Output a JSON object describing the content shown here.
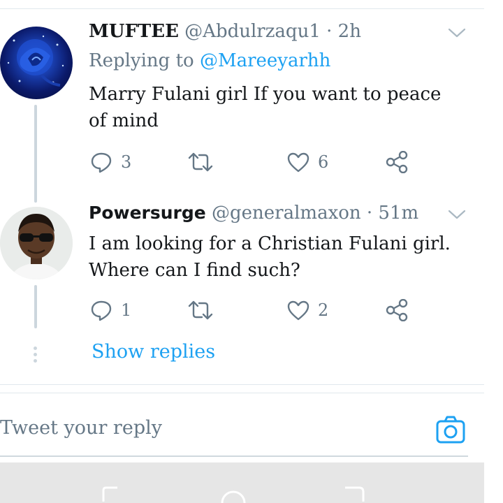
{
  "tweets": [
    {
      "name": "MUFTEE",
      "handle": "@Abdulrzaqu1",
      "time": "· 2h",
      "replying_to_label": "Replying to",
      "replying_to_user": "@Mareeyarhh",
      "text": "Marry Fulani girl If you want to peace of mind",
      "replies": "3",
      "likes": "6"
    },
    {
      "name": "Powersurge",
      "handle": "@generalmaxon",
      "time": "· 51m",
      "text": "I am looking for a Christian Fulani girl. Where can I find such?",
      "replies": "1",
      "likes": "2"
    }
  ],
  "show_replies": "Show replies",
  "composer": {
    "placeholder": "Tweet your reply"
  },
  "icons": {
    "chevron": "chevron-down-icon",
    "reply": "reply-icon",
    "retweet": "retweet-icon",
    "like": "heart-icon",
    "share": "share-icon",
    "camera": "camera-icon"
  },
  "colors": {
    "accent": "#1da1f2",
    "muted": "#657786",
    "text": "#14171a"
  }
}
